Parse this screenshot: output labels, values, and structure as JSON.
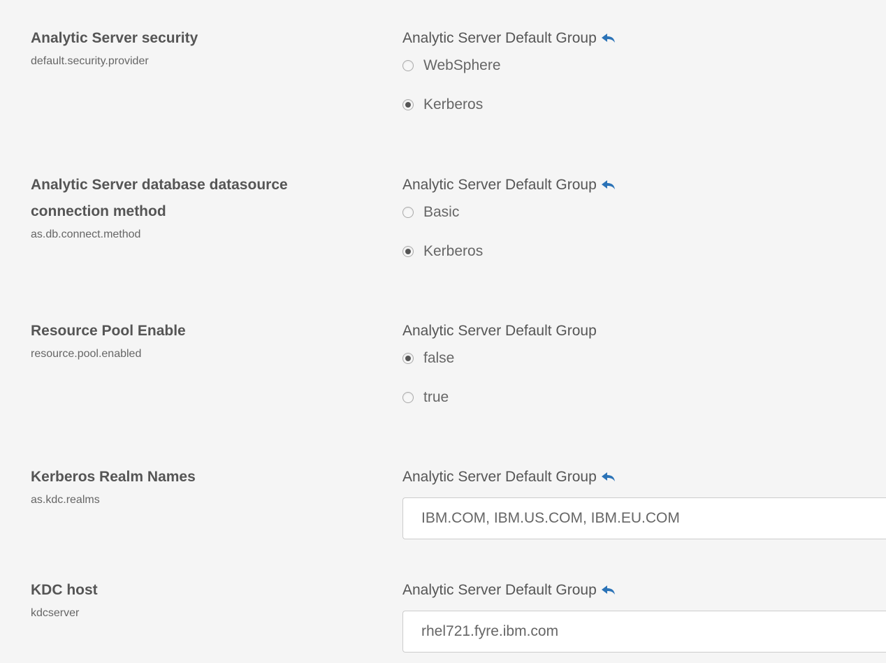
{
  "settings": [
    {
      "title": "Analytic Server security",
      "key": "default.security.provider",
      "group": "Analytic Server Default Group",
      "options": [
        "WebSphere",
        "Kerberos"
      ],
      "selected": "Kerberos"
    },
    {
      "title_line1": "Analytic Server database datasource",
      "title_line2": "connection method",
      "key": "as.db.connect.method",
      "group": "Analytic Server Default Group",
      "options": [
        "Basic",
        "Kerberos"
      ],
      "selected": "Kerberos"
    },
    {
      "title": "Resource Pool Enable",
      "key": "resource.pool.enabled",
      "group": "Analytic Server Default Group",
      "options": [
        "false",
        "true"
      ],
      "selected": "false"
    },
    {
      "title": "Kerberos Realm Names",
      "key": "as.kdc.realms",
      "group": "Analytic Server Default Group",
      "value": "IBM.COM, IBM.US.COM, IBM.EU.COM"
    },
    {
      "title": "KDC host",
      "key": "kdcserver",
      "group": "Analytic Server Default Group",
      "value": "rhel721.fyre.ibm.com"
    }
  ],
  "icons": {
    "undo": "undo-arrow-icon"
  },
  "colors": {
    "undo_icon": "#2b73b7",
    "background": "#f5f5f5"
  }
}
